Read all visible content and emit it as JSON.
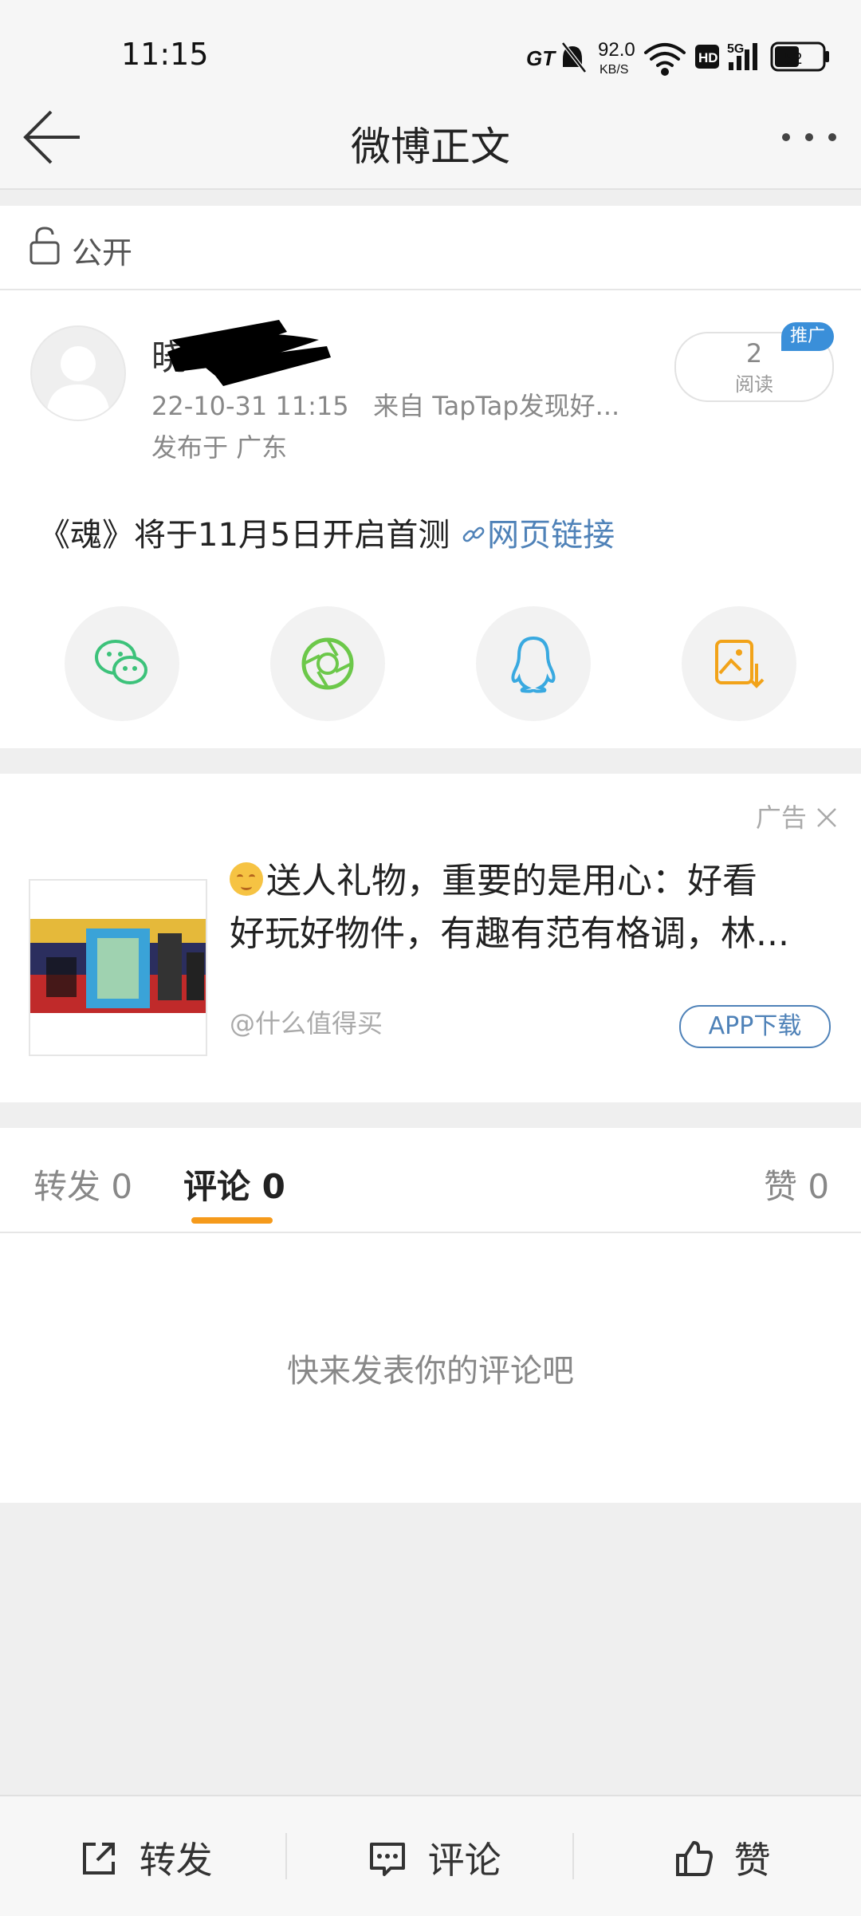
{
  "status": {
    "time": "11:15",
    "speed": "92.0",
    "speed_unit": "KB/S",
    "battery": "52",
    "gt": "GT",
    "hd": "HD",
    "network": "5G"
  },
  "nav": {
    "title": "微博正文"
  },
  "visibility": {
    "label": "公开"
  },
  "post": {
    "username_visible": "晓",
    "time": "22-10-31 11:15",
    "source": "来自 TapTap发现好...",
    "location": "发布于 广东",
    "reads": "2",
    "reads_label": "阅读",
    "promo_badge": "推广",
    "content_text": "《魂》将于11月5日开启首测",
    "link_text": "网页链接"
  },
  "ad": {
    "tag": "广告",
    "line1": "送人礼物，重要的是用心：好看",
    "line2": "好玩好物件，有趣有范有格调，林...",
    "source": "@什么值得买",
    "button": "APP下载"
  },
  "tabs": {
    "repost": "转发 0",
    "comment": "评论 0",
    "like": "赞 0"
  },
  "comments": {
    "empty": "快来发表你的评论吧"
  },
  "bottom": {
    "repost": "转发",
    "comment": "评论",
    "like": "赞"
  },
  "colors": {
    "accent": "#f59a1b",
    "link": "#4f82b8",
    "wechat": "#3cc27a",
    "moments": "#6cc84a",
    "qq": "#39a9e0",
    "save": "#f2a319"
  }
}
